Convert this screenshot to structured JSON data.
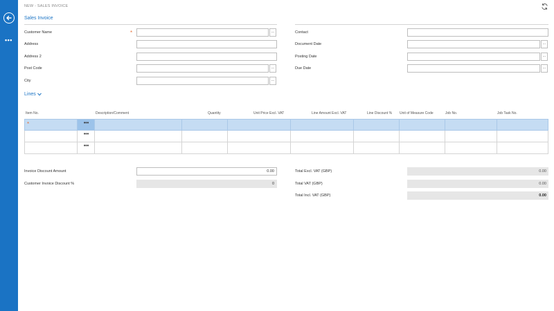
{
  "breadcrumb": "NEW - SALES INVOICE",
  "icons": {
    "back": "back-arrow-icon",
    "more": "more-dots-icon",
    "refresh": "refresh-icon"
  },
  "section_title": "Sales Invoice",
  "left_fields": {
    "customer_name": {
      "label": "Customer Name",
      "value": ""
    },
    "address": {
      "label": "Address",
      "value": ""
    },
    "address2": {
      "label": "Address 2",
      "value": ""
    },
    "post_code": {
      "label": "Post Code",
      "value": ""
    },
    "city": {
      "label": "City",
      "value": ""
    }
  },
  "right_fields": {
    "contact": {
      "label": "Contact",
      "value": ""
    },
    "document_date": {
      "label": "Document Date",
      "value": ""
    },
    "posting_date": {
      "label": "Posting Date",
      "value": ""
    },
    "due_date": {
      "label": "Due Date",
      "value": ""
    }
  },
  "required_mark": "*",
  "lookup_label": "...",
  "lines": {
    "title": "Lines",
    "columns": [
      "Item No.",
      "Description/Comment",
      "Quantity",
      "Unit Price Excl. VAT",
      "Line Amount Excl. VAT",
      "Line Discount %",
      "Unit of Measure Code",
      "Job No.",
      "Job Task No."
    ],
    "row_more": "•••"
  },
  "discount": {
    "invoice_discount_amount": {
      "label": "Invoice Discount Amount",
      "value": "0.00"
    },
    "customer_invoice_discount": {
      "label": "Customer Invoice Discount %",
      "value": "0"
    }
  },
  "totals": {
    "excl_vat": {
      "label": "Total Excl. VAT (GBP)",
      "value": "0.00"
    },
    "vat": {
      "label": "Total VAT (GBP)",
      "value": "0.00"
    },
    "incl_vat": {
      "label": "Total Incl. VAT (GBP)",
      "value": "0.00"
    }
  },
  "colors": {
    "accent": "#1a73c4",
    "required": "#e8743b",
    "selected_row": "#c5dcf3"
  }
}
